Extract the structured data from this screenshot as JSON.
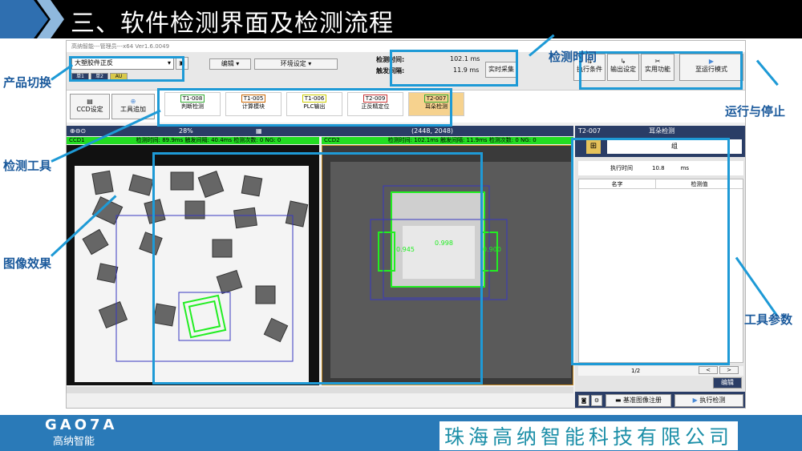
{
  "slide": {
    "title": "三、软件检测界面及检测流程",
    "logo": "GAO7A",
    "brand": "高纳智能",
    "company": "珠海高纳智能科技有限公司",
    "labels": {
      "product_switch": "产品切换",
      "detect_tool": "检测工具",
      "image_effect": "图像效果",
      "detect_time": "检测时间",
      "run_stop": "运行与停止",
      "tool_params": "工具参数"
    }
  },
  "window": {
    "title": "高纳智能---管理员---x64 Ver1.6.0049"
  },
  "toolbar": {
    "product_combo": "大塑胶件正反",
    "menu_edit": "编辑",
    "menu_env": "环境设定",
    "detect_time_label": "检测时间:",
    "detect_time_value": "102.1 ms",
    "trigger_label": "触发间隔:",
    "trigger_value": "11.9 ms",
    "realtime_btn": "实时采集",
    "exec_cond_btn": "执行条件",
    "output_btn": "输出设定",
    "utility_btn": "实用功能",
    "run_mode_btn": "至运行模式",
    "tabs": [
      "单1",
      "单2",
      "AU"
    ]
  },
  "tools_row": {
    "ccd_btn": "CCD设定",
    "tool_add_btn": "工具追加",
    "tools": [
      {
        "id": "T1-008",
        "name": "判断检测"
      },
      {
        "id": "T1-005",
        "name": "计算模块"
      },
      {
        "id": "T1-006",
        "name": "PLC输出"
      },
      {
        "id": "T2-009",
        "name": "正反精定位"
      },
      {
        "id": "T2-007",
        "name": "耳朵检测"
      }
    ]
  },
  "viewbar": {
    "zoom": "28%",
    "coords": "(2448, 2048)"
  },
  "ccd1": {
    "name": "CCD1",
    "status": "检测时间: 89.9ms  触发间隔: 40.4ms  检测次数: 0  NG: 0"
  },
  "ccd2": {
    "name": "CCD2",
    "status": "检测时间: 102.1ms  触发间隔: 11.9ms  检测次数: 0  NG: 0",
    "readings": [
      "0.945",
      "0.998",
      "0.900"
    ]
  },
  "right_panel": {
    "tool_id": "T2-007",
    "tool_name": "耳朵检测",
    "sub_label": "组",
    "exec_time_label": "执行时间",
    "exec_time_value": "10.8",
    "exec_time_unit": "ms",
    "col_name": "名字",
    "col_value": "检测值",
    "page": "1/2",
    "prev": "<",
    "next": ">",
    "edit_btn": "编辑",
    "register_btn": "基准图像注册",
    "run_btn": "执行检测"
  }
}
